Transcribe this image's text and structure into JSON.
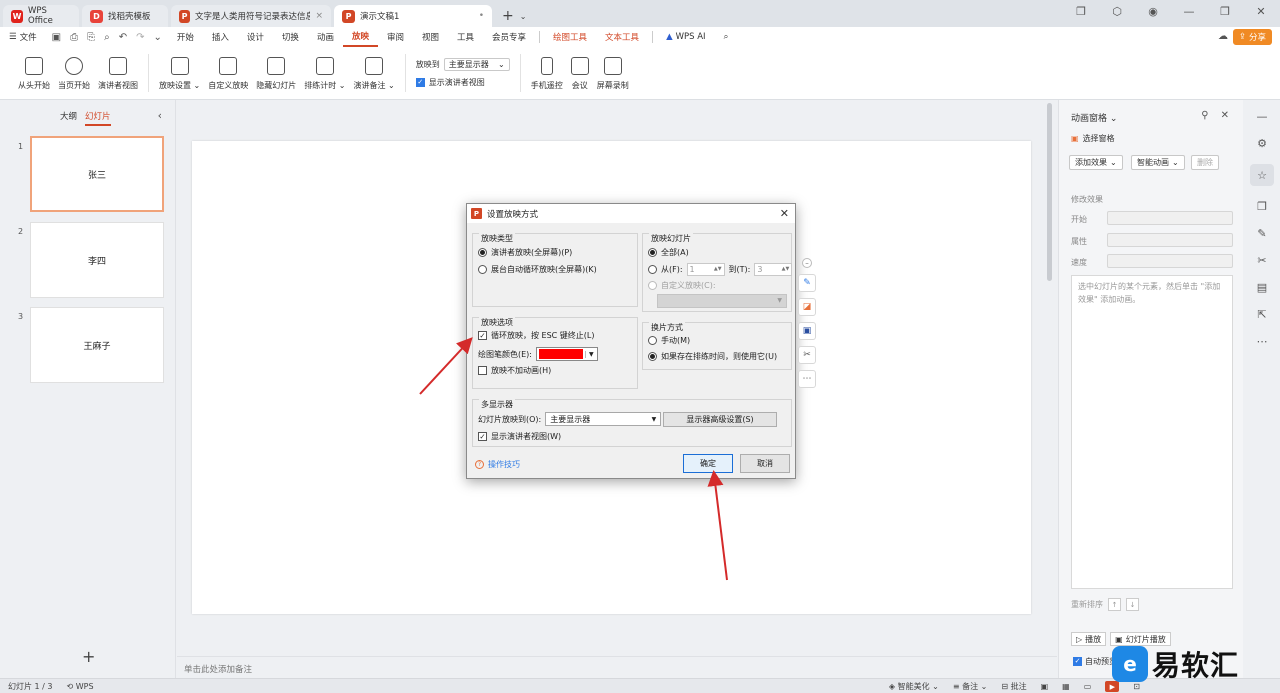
{
  "tabs": [
    {
      "label": "WPS Office",
      "logo": "W",
      "logo_color": "#e0231c",
      "state": "inactive"
    },
    {
      "label": "找稻壳模板",
      "logo": "D",
      "logo_color": "#e8433a",
      "state": "inactive"
    },
    {
      "label": "文字是人类用符号记录表达信息以…",
      "logo": "P",
      "logo_color": "#d24726",
      "state": "inactive"
    },
    {
      "label": "演示文稿1",
      "logo": "P",
      "logo_color": "#d24726",
      "state": "active"
    }
  ],
  "menubar": {
    "file": "文件",
    "items": [
      "开始",
      "插入",
      "设计",
      "切换",
      "动画",
      "放映",
      "审阅",
      "视图",
      "工具",
      "会员专享"
    ],
    "active": "放映",
    "context": [
      "绘图工具",
      "文本工具"
    ],
    "wps_ai": "WPS AI",
    "share": "分享"
  },
  "ribbon": {
    "from_start": "从头开始",
    "from_current": "当页开始",
    "presenter_view": "演讲者视图",
    "show_setup": "放映设置",
    "custom_show": "自定义放映",
    "hide_slide": "隐藏幻灯片",
    "rehearse": "排练计时",
    "speaker_notes": "演讲备注",
    "show_to_label": "放映到",
    "show_to_value": "主要显示器",
    "show_presenter_view": "显示演讲者视图",
    "phone_remote": "手机遥控",
    "meeting": "会议",
    "screen_record": "屏幕录制"
  },
  "leftpanel": {
    "tab_outline": "大纲",
    "tab_slides": "幻灯片",
    "slides": [
      {
        "num": "1",
        "text": "张三"
      },
      {
        "num": "2",
        "text": "李四"
      },
      {
        "num": "3",
        "text": "王麻子"
      }
    ]
  },
  "notes_placeholder": "单击此处添加备注",
  "anim_pane": {
    "title": "动画窗格",
    "selection_pane": "选择窗格",
    "add_effect": "添加效果",
    "smart_anim": "智能动画",
    "delete": "删除",
    "modify_effect": "修改效果",
    "start": "开始",
    "property": "属性",
    "speed": "速度",
    "hint": "选中幻灯片的某个元素，然后单击 \"添加效果\" 添加动画。",
    "reorder": "重新排序",
    "play": "播放",
    "slide_play": "幻灯片播放",
    "auto_preview": "自动预览"
  },
  "status": {
    "slide_info": "幻灯片 1 / 3",
    "wps": "WPS",
    "smart_beautify": "智能美化",
    "notes": "备注",
    "comments": "批注"
  },
  "dialog": {
    "title": "设置放映方式",
    "show_type": {
      "title": "放映类型",
      "options": [
        "演讲者放映(全屏幕)(P)",
        "展台自动循环放映(全屏幕)(K)"
      ],
      "selected": 0
    },
    "show_slides": {
      "title": "放映幻灯片",
      "all": "全部(A)",
      "from": "从(F):",
      "from_value": "1",
      "to": "到(T):",
      "to_value": "3",
      "custom": "自定义放映(C):"
    },
    "show_options": {
      "title": "放映选项",
      "loop": "循环放映，按 ESC 键终止(L)",
      "loop_checked": true,
      "pen_color_label": "绘图笔颜色(E):",
      "pen_color": "#ff0000",
      "no_animation": "放映不加动画(H)",
      "no_animation_checked": false
    },
    "advance": {
      "title": "换片方式",
      "manual": "手动(M)",
      "timings": "如果存在排练时间，则使用它(U)",
      "selected": 1
    },
    "multi_monitor": {
      "title": "多显示器",
      "show_on_label": "幻灯片放映到(O):",
      "show_on_value": "主要显示器",
      "advanced_btn": "显示器高级设置(S)",
      "presenter_view": "显示演讲者视图(W)",
      "presenter_view_checked": true
    },
    "help": "操作技巧",
    "ok": "确定",
    "cancel": "取消"
  },
  "annotation_color": "#d42a2a",
  "watermark": {
    "badge": "e",
    "text": "易软汇"
  }
}
